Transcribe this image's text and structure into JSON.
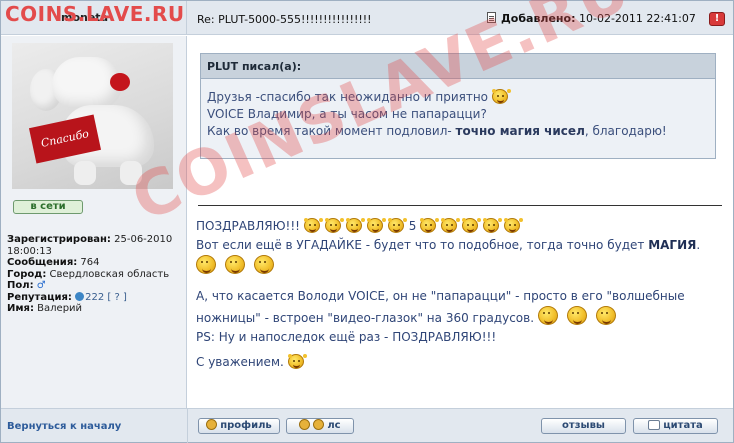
{
  "header": {
    "watermark": "COINS.LAVE.RU",
    "author": "moneta",
    "subject": "Re: PLUT-5000-555!!!!!!!!!!!!!!!!",
    "posted_label": "Добавлено:",
    "posted_date": "10-02-2011 22:41:07",
    "report_label": "!"
  },
  "sidebar": {
    "avatar_card_text": "Спасибо",
    "online_label": "в сети",
    "registered_label": "Зарегистрирован:",
    "registered_value": "25-06-2010 18:00:13",
    "messages_label": "Сообщения:",
    "messages_value": "764",
    "city_label": "Город:",
    "city_value": "Свердловская область",
    "gender_label": "Пол:",
    "gender_value": "♂",
    "reputation_label": "Репутация:",
    "reputation_value": "222",
    "reputation_link": "[ ? ]",
    "name_label": "Имя:",
    "name_value": "Валерий"
  },
  "quote": {
    "header": "PLUT писал(а):",
    "line1": "Друзья -спасибо так неожиданно и приятно",
    "line2": "VOICE Владимир, а ты часом не папарацци?",
    "line3_pre": "Как во время такой момент подловил-",
    "line3_bold": "точно магия чисел",
    "line3_post": ", благодарю!"
  },
  "message": {
    "congrats": "ПОЗДРАВЛЯЮ!!!",
    "count": "5",
    "line2_pre": "Вот если ещё в УГАДАЙКЕ - будет что то подобное, тогда точно будет",
    "line2_bold": "МАГИЯ",
    "line2_post": ".",
    "para2": "А, что касается Володи VOICE, он не \"папарацци\" - просто в его \"волшебные ножницы\" - встроен \"видео-глазок\" на 360 градусов.",
    "ps": "PS: Ну и напоследок ещё раз - ПОЗДРАВЛЯЮ!!!",
    "regards": "С уважением."
  },
  "watermark_diag": "COINSLAVE.RU",
  "footer": {
    "back": "Вернуться к началу",
    "profile": "профиль",
    "pm": "лс",
    "reviews": "отзывы",
    "quote": "цитата"
  },
  "icons": {
    "smiley": "smiley-icon",
    "clap": "clapping-smiley-icon"
  },
  "colors": {
    "header_bg": "#e2e8ef",
    "sidebar_bg": "#eef1f5",
    "text_blue": "#2f4577",
    "watermark_red": "#e34b4b",
    "link_blue": "#2e5c9b"
  }
}
